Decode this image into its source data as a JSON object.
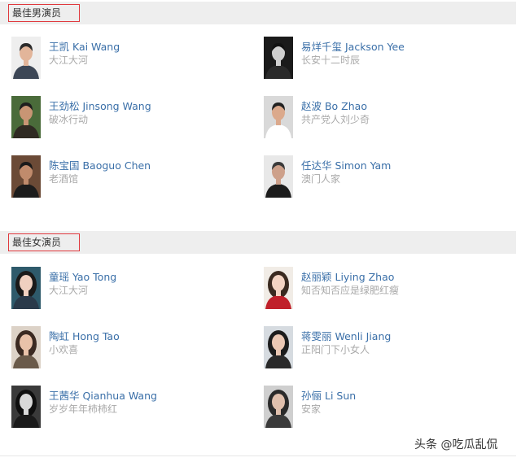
{
  "sections": [
    {
      "title": "最佳男演员",
      "people": [
        {
          "name": "王凯 Kai Wang",
          "work": "大江大河",
          "bg": "#eeeeee",
          "skin": "#e2b59a",
          "hair": "#2b2b2b",
          "cloth": "#3d4756"
        },
        {
          "name": "易烊千玺 Jackson Yee",
          "work": "长安十二时辰",
          "bg": "#1a1a1a",
          "skin": "#cfcfcf",
          "hair": "#111111",
          "cloth": "#2a2a2a"
        },
        {
          "name": "王劲松 Jinsong Wang",
          "work": "破冰行动",
          "bg": "#4a6b3a",
          "skin": "#c89574",
          "hair": "#1e1e1e",
          "cloth": "#2f2a22"
        },
        {
          "name": "赵波 Bo Zhao",
          "work": "共产党人刘少奇",
          "bg": "#d9d9d9",
          "skin": "#dba98c",
          "hair": "#222222",
          "cloth": "#ffffff"
        },
        {
          "name": "陈宝国 Baoguo Chen",
          "work": "老酒馆",
          "bg": "#6b4a36",
          "skin": "#c08b6c",
          "hair": "#1a1a1a",
          "cloth": "#1c1c1c"
        },
        {
          "name": "任达华 Simon Yam",
          "work": "澳门人家",
          "bg": "#e8e8e8",
          "skin": "#cda08a",
          "hair": "#3a3a3a",
          "cloth": "#1c1c1c"
        }
      ]
    },
    {
      "title": "最佳女演员",
      "people": [
        {
          "name": "童瑶 Yao Tong",
          "work": "大江大河",
          "bg": "#2e5a6b",
          "skin": "#f0d0c0",
          "hair": "#1a1a1a",
          "cloth": "#2a3a4a"
        },
        {
          "name": "赵丽颖 Liying Zhao",
          "work": "知否知否应是绿肥红瘦",
          "bg": "#f1ece6",
          "skin": "#f3d4c3",
          "hair": "#3a2a20",
          "cloth": "#c0202a"
        },
        {
          "name": "陶虹 Hong Tao",
          "work": "小欢喜",
          "bg": "#dcd2c7",
          "skin": "#e9c2a9",
          "hair": "#3b2a22",
          "cloth": "#6a5a4a"
        },
        {
          "name": "蒋雯丽 Wenli Jiang",
          "work": "正阳门下小女人",
          "bg": "#d6dbe0",
          "skin": "#ebc8b4",
          "hair": "#1c1c1c",
          "cloth": "#2a2a2a"
        },
        {
          "name": "王茜华 Qianhua Wang",
          "work": "岁岁年年柿柿红",
          "bg": "#3a3a3a",
          "skin": "#d8d8d8",
          "hair": "#0f0f0f",
          "cloth": "#1a1a1a"
        },
        {
          "name": "孙俪 Li Sun",
          "work": "安家",
          "bg": "#cfcfcf",
          "skin": "#e0c0ad",
          "hair": "#2a2a2a",
          "cloth": "#3a3a3a"
        }
      ]
    }
  ],
  "watermark": "头条 @吃瓜乱侃"
}
